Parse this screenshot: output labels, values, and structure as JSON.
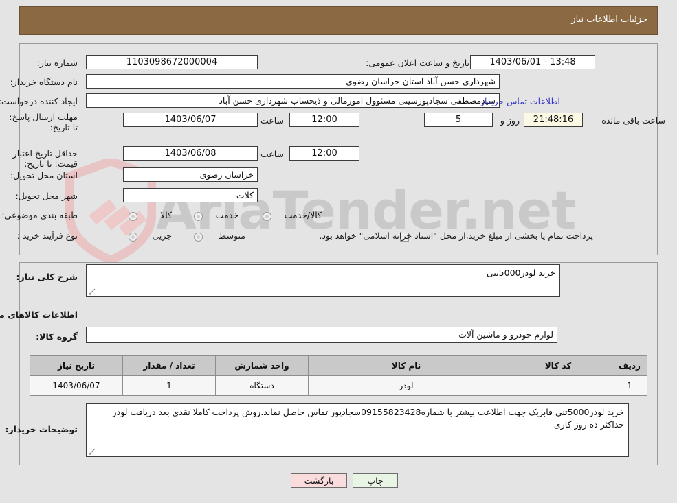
{
  "header": {
    "title": "جزئیات اطلاعات نیاز"
  },
  "form": {
    "need_number_label": "شماره نیاز:",
    "need_number": "1103098672000004",
    "announce_label": "تاریخ و ساعت اعلان عمومی:",
    "announce_value": "1403/06/01 - 13:48",
    "buyer_org_label": "نام دستگاه خریدار:",
    "buyer_org": "شهرداری حسن آباد استان خراسان رضوی",
    "creator_label": "ایجاد کننده درخواست:",
    "creator": "سیدمصطفی سجادپورسینی مسئوول امورمالی و ذیحساب شهرداری حسن آباد",
    "contact_link": "اطلاعات تماس خریدار",
    "deadline_label": "مهلت ارسال پاسخ: تا تاریخ:",
    "deadline_date": "1403/06/07",
    "time_label": "ساعت",
    "deadline_time": "12:00",
    "days_left": "5",
    "days_word": "روز و",
    "countdown": "21:48:16",
    "remaining_word": "ساعت باقی مانده",
    "price_valid_label": "حداقل تاریخ اعتبار قیمت: تا تاریخ:",
    "price_valid_date": "1403/06/08",
    "price_valid_time": "12:00",
    "province_label": "استان محل تحویل:",
    "province": "خراسان رضوی",
    "city_label": "شهر محل تحویل:",
    "city": "کلات",
    "category_label": "طبقه بندی موضوعی:",
    "category_options": [
      "کالا",
      "خدمت",
      "کالا/خدمت"
    ],
    "process_label": "نوع فرآیند خرید :",
    "process_options": [
      "جزیی",
      "متوسط"
    ],
    "treasury_note": "پرداخت تمام یا بخشی از مبلغ خرید،از محل \"اسناد خزانه اسلامی\" خواهد بود."
  },
  "description": {
    "summary_label": "شرح کلی نیاز:",
    "summary_value": "خرید لودر5000تنی",
    "goods_heading": "اطلاعات کالاهای مورد نیاز",
    "group_label": "گروه کالا:",
    "group_value": "لوازم خودرو و ماشین آلات"
  },
  "table": {
    "columns": [
      "ردیف",
      "کد کالا",
      "نام کالا",
      "واحد شمارش",
      "تعداد / مقدار",
      "تاریخ نیاز"
    ],
    "rows": [
      {
        "row": "1",
        "code": "--",
        "name": "لودر",
        "unit": "دستگاه",
        "qty": "1",
        "date": "1403/06/07"
      }
    ]
  },
  "notes": {
    "label": "توضیحات خریدار:",
    "value": "خرید لودر5000تنی فابریک   جهت اطلاعت بیشتر با شماره09155823428سجادپور تماس حاصل نماند.روش پرداخت کاملا نقدی بعد دریافت لودر حداکثر ده روز کاری"
  },
  "buttons": {
    "print": "چاپ",
    "back": "بازگشت"
  },
  "watermark": {
    "text": "AriaTender.net"
  },
  "colors": {
    "header_bar": "#8b6a43",
    "page_bg": "#e4e4e4",
    "link": "#3838c8",
    "countdown_bg": "#fbf8e3",
    "print_btn": "#e8f5e4",
    "back_btn": "#fadcdc",
    "table_header": "#c9c9c9"
  }
}
